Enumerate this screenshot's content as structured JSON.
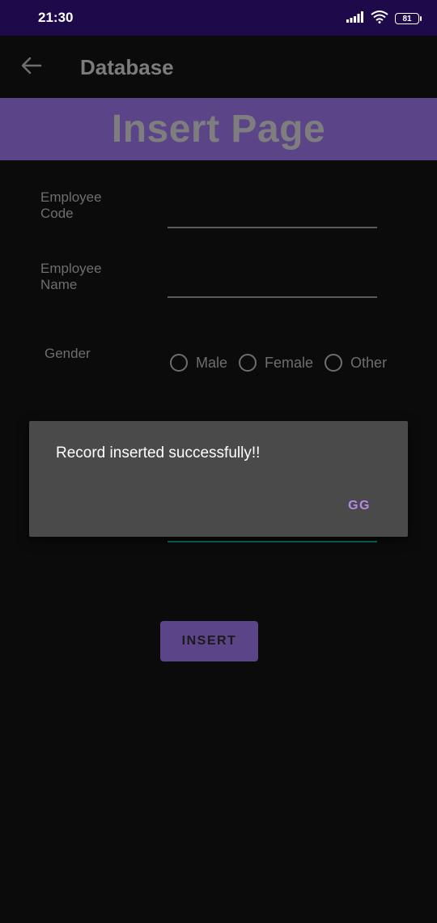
{
  "status_bar": {
    "time": "21:30",
    "battery": "81",
    "signal_icon": "signal-bars-icon",
    "wifi_icon": "wifi-icon"
  },
  "app_bar": {
    "back_icon": "arrow-left-icon",
    "title": "Database"
  },
  "banner": {
    "text": "Insert Page",
    "color": "#5b4487"
  },
  "form": {
    "employee_code_label": "Employee\nCode",
    "employee_code_value": "",
    "employee_name_label": "Employee\nName",
    "employee_name_value": "",
    "gender_label": "Gender",
    "gender_options": [
      "Male",
      "Female",
      "Other"
    ]
  },
  "insert_button_label": "INSERT",
  "dialog": {
    "message": "Record inserted successfully!!",
    "button_label": "GG",
    "accent_color": "#b48ae8"
  },
  "colors": {
    "status_bar": "#1e0a4a",
    "background": "#0b0b0b",
    "focus_line": "#0f6f6a"
  }
}
